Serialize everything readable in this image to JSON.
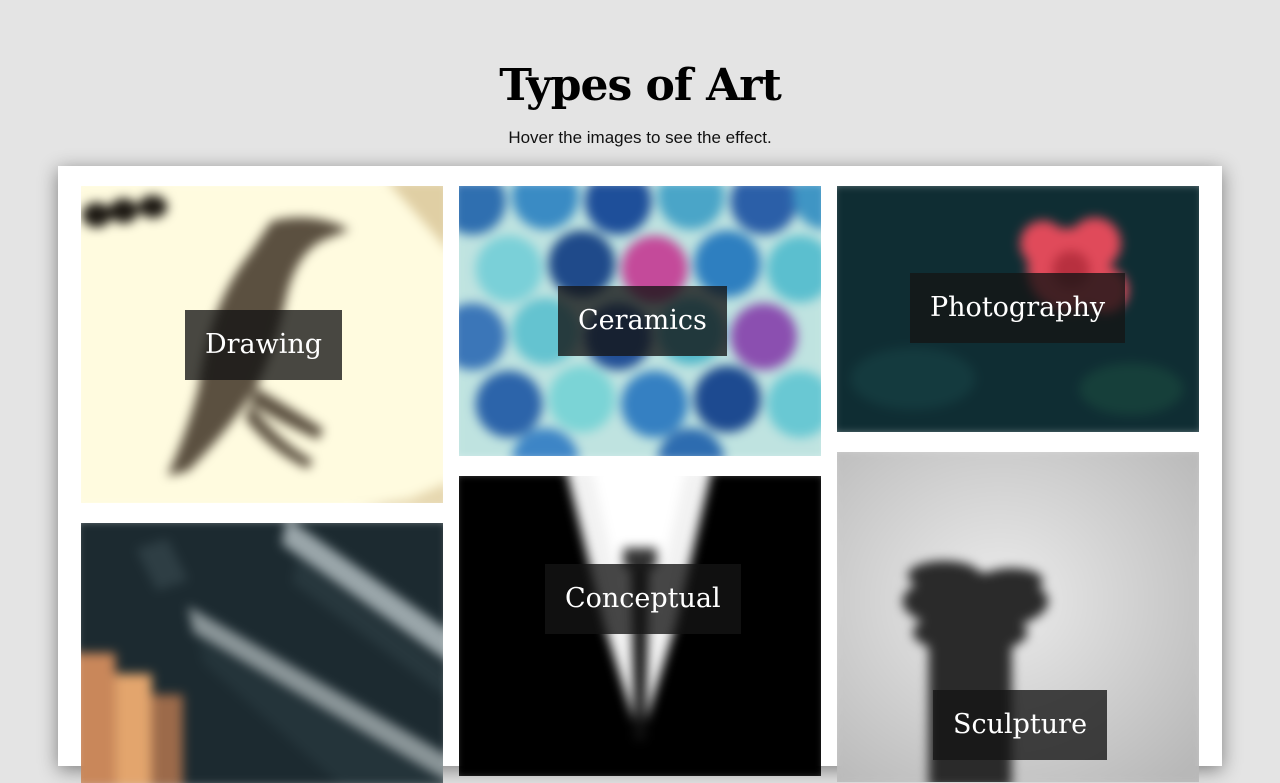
{
  "header": {
    "title": "Types of Art",
    "subtitle": "Hover the images to see the effect."
  },
  "gallery": {
    "items": [
      {
        "label": "Drawing",
        "image": "crow-drawing",
        "color": "#f7f1d4"
      },
      {
        "label": "Ceramics",
        "image": "ceramic-tiles",
        "color": "#3a7fae"
      },
      {
        "label": "Photography",
        "image": "red-rose",
        "color": "#0f2d33"
      },
      {
        "label": "",
        "image": "building-facade",
        "color": "#1c2a30"
      },
      {
        "label": "Conceptual",
        "image": "suit-silhouette",
        "color": "#000000"
      },
      {
        "label": "Sculpture",
        "image": "statue",
        "color": "#d0d0d0"
      }
    ]
  }
}
